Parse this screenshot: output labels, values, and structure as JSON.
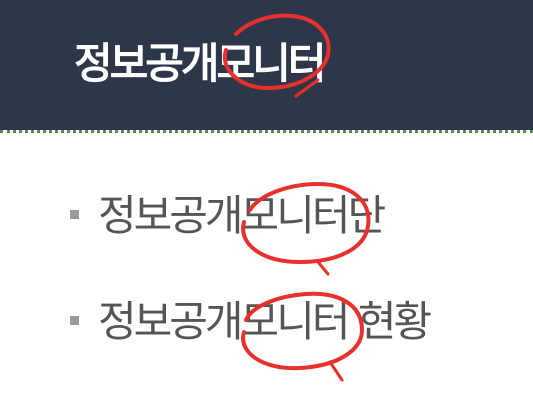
{
  "header": {
    "title": "정보공개모니터"
  },
  "menu": {
    "items": [
      {
        "label": "정보공개모니터단"
      },
      {
        "label": "정보공개모니터 현황"
      }
    ]
  },
  "colors": {
    "header_bg": "#2e3649",
    "accent_circle": "#e8302c",
    "divider": "#5a8a4a"
  }
}
